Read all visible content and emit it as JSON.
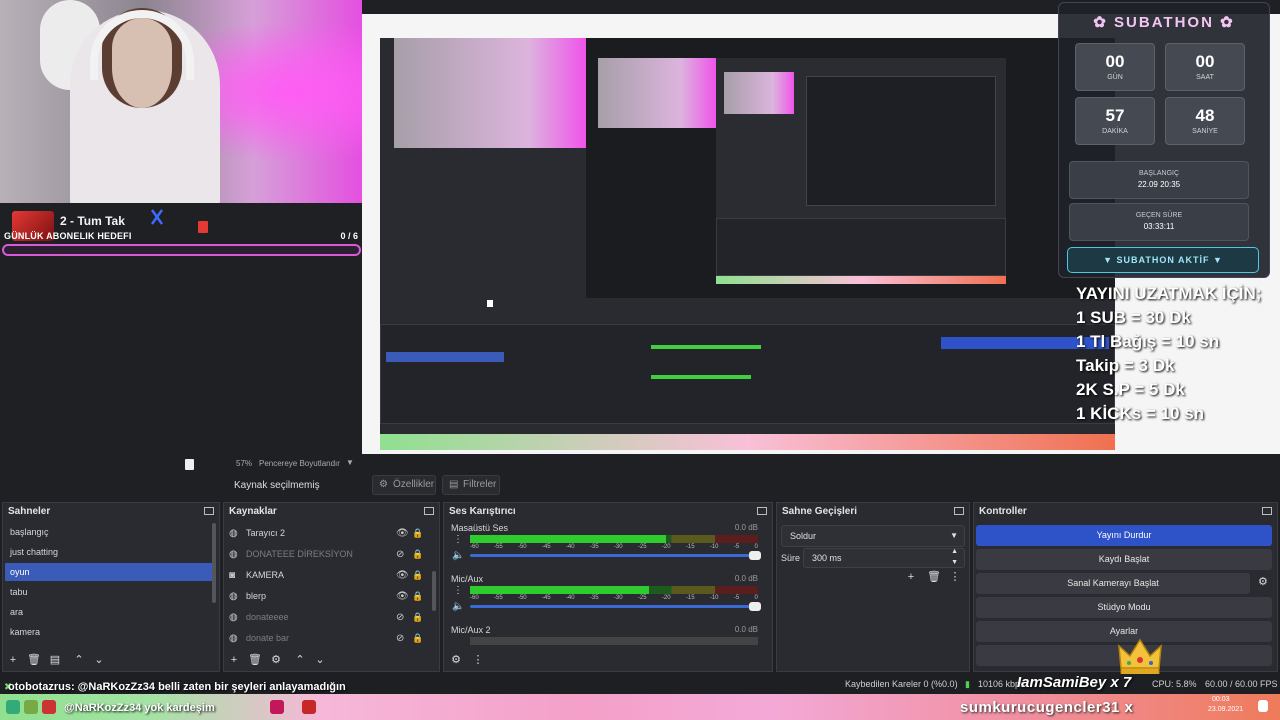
{
  "goal": {
    "title": "2 - Tum Tak",
    "label": "GÜNLÜK ABONELIK HEDEFI",
    "count": "0  / 6"
  },
  "subathon": {
    "title": "SUBATHON",
    "days": "00",
    "days_label": "GÜN",
    "hours": "00",
    "hours_label": "SAAT",
    "minutes": "57",
    "minutes_label": "DAKİKA",
    "seconds": "48",
    "seconds_label": "SANİYE",
    "start_label": "BAŞLANGIÇ",
    "start_value": "22.09 20:35",
    "elapsed_label": "GEÇEN SÜRE",
    "elapsed_value": "03:33:11",
    "active": "SUBATHON AKTİF"
  },
  "extend": {
    "line1": "YAYINI UZATMAK İÇİN;",
    "line2": "1 SUB = 30 Dk",
    "line3": "1 Tl Bağış = 10 sn",
    "line4": "Takip = 3 Dk",
    "line5": "2K S.P = 5 Dk",
    "line6": "1 KİCKs = 10 sn"
  },
  "preview": {
    "zoom": "57%",
    "fit_label": "Pencereye Boyutlandır",
    "no_source": "Kaynak seçilmemiş",
    "properties": "Özellikler",
    "filters": "Filtreler"
  },
  "scenes": {
    "title": "Sahneler",
    "items": [
      "başlangıç",
      "just chatting",
      "oyun",
      "tabu",
      "ara",
      "kamera"
    ],
    "active_index": 2
  },
  "sources": {
    "title": "Kaynaklar",
    "items": [
      {
        "label": "Tarayıcı 2",
        "icon": "globe-icon",
        "visible": true
      },
      {
        "label": "DONATEEE DİREKSİYON",
        "icon": "globe-icon",
        "visible": false
      },
      {
        "label": "KAMERA",
        "icon": "camera-icon",
        "visible": true
      },
      {
        "label": "blerp",
        "icon": "globe-icon",
        "visible": true
      },
      {
        "label": "donateeee",
        "icon": "globe-icon",
        "visible": false
      },
      {
        "label": "donate bar",
        "icon": "globe-icon",
        "visible": false
      }
    ]
  },
  "mixer": {
    "title": "Ses Karıştırıcı",
    "channels": [
      {
        "name": "Masaüstü Ses",
        "db": "0.0 dB",
        "level": 0.68
      },
      {
        "name": "Mic/Aux",
        "db": "0.0 dB",
        "level": 0.62
      },
      {
        "name": "Mic/Aux 2",
        "db": "0.0 dB",
        "level": 0.0
      }
    ],
    "scale": [
      "-60",
      "-55",
      "-50",
      "-45",
      "-40",
      "-35",
      "-30",
      "-25",
      "-20",
      "-15",
      "-10",
      "-5",
      "0"
    ]
  },
  "transitions": {
    "title": "Sahne Geçişleri",
    "selected": "Soldur",
    "duration_label": "Süre",
    "duration_value": "300 ms"
  },
  "controls": {
    "title": "Kontroller",
    "stop_stream": "Yayını Durdur",
    "start_record": "Kaydı Başlat",
    "virtual_cam": "Sanal Kamerayı Başlat",
    "studio_mode": "Stüdyo Modu",
    "settings": "Ayarlar"
  },
  "status": {
    "dropped": "Kaybedilen Kareler 0 (%0.0)",
    "bitrate": "10106 kbps",
    "cpu": "CPU: 5.8%",
    "fps": "60.00 / 60.00 FPS"
  },
  "chat": {
    "line1": "otobotazrus: @NaRKozZz34 belli zaten bir şeyleri anlayamadığın",
    "line2": "@NaRKozZz34 yok kardeşim",
    "gifter": "IamSamiBey",
    "gifter_count": "x 7"
  },
  "taskbar": {
    "text": "sumkurucugencler31 x",
    "time": "00:03",
    "date": "23.09.2021"
  }
}
